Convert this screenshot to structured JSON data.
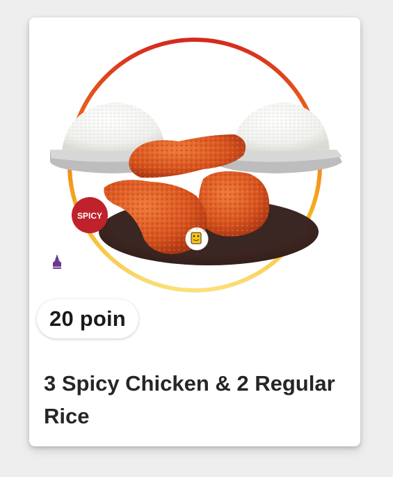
{
  "product": {
    "points_label": "20 poin",
    "title": "3 Spicy Chicken & 2 Regular Rice",
    "badge_text": "SPICY",
    "image_icons": [
      "halal-logo-icon",
      "mascot-badge-icon"
    ]
  },
  "colors": {
    "accent_red": "#d42a1e",
    "accent_yellow": "#f5c518",
    "badge_red": "#c0222c",
    "chicken": "#d8541f",
    "plate_dark": "#3a2623",
    "halal_purple": "#6b3a8e",
    "card_bg": "#ffffff",
    "page_bg": "#eeeeee"
  }
}
